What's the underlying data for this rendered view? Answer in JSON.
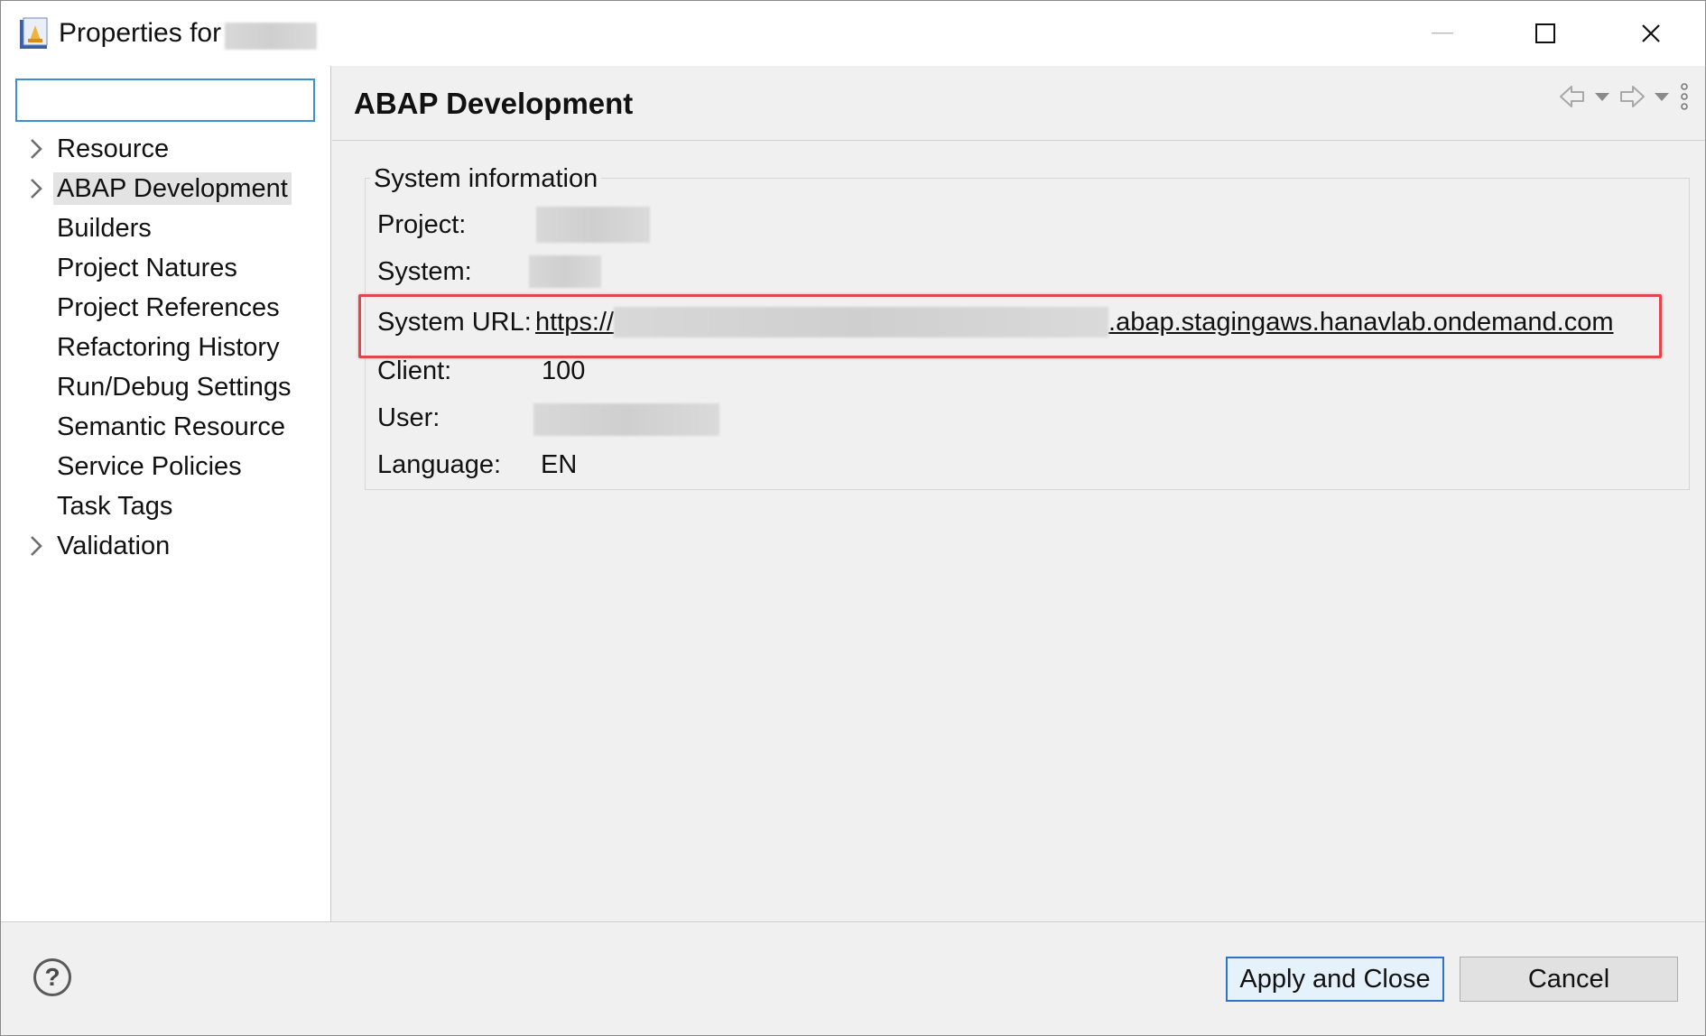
{
  "window": {
    "title": "Properties for",
    "accent_color": "#2c74c9"
  },
  "filter": {
    "value": ""
  },
  "tree": {
    "items": [
      {
        "label": "Resource",
        "expandable": true
      },
      {
        "label": "ABAP Development",
        "expandable": true,
        "selected": true
      },
      {
        "label": "Builders",
        "expandable": false
      },
      {
        "label": "Project Natures",
        "expandable": false
      },
      {
        "label": "Project References",
        "expandable": false
      },
      {
        "label": "Refactoring History",
        "expandable": false
      },
      {
        "label": "Run/Debug Settings",
        "expandable": false
      },
      {
        "label": "Semantic Resource",
        "expandable": false
      },
      {
        "label": "Service Policies",
        "expandable": false
      },
      {
        "label": "Task Tags",
        "expandable": false
      },
      {
        "label": "Validation",
        "expandable": true
      }
    ]
  },
  "page": {
    "title": "ABAP Development",
    "nav_icons": [
      "back-arrow-icon",
      "back-menu-chevron-icon",
      "forward-arrow-icon",
      "forward-menu-chevron-icon",
      "more-vertical-icon"
    ]
  },
  "system_info": {
    "group_label": "System information",
    "project_label": "Project:",
    "system_label": "System:",
    "url_label": "System URL:",
    "url_prefix": "https://",
    "url_suffix": ".abap.stagingaws.hanavlab.ondemand.com",
    "client_label": "Client:",
    "client_value": "100",
    "user_label": "User:",
    "language_label": "Language:",
    "language_value": "EN",
    "highlight_color": "#e0474c"
  },
  "footer": {
    "help_symbol": "?",
    "apply_label": "Apply and Close",
    "cancel_label": "Cancel"
  }
}
